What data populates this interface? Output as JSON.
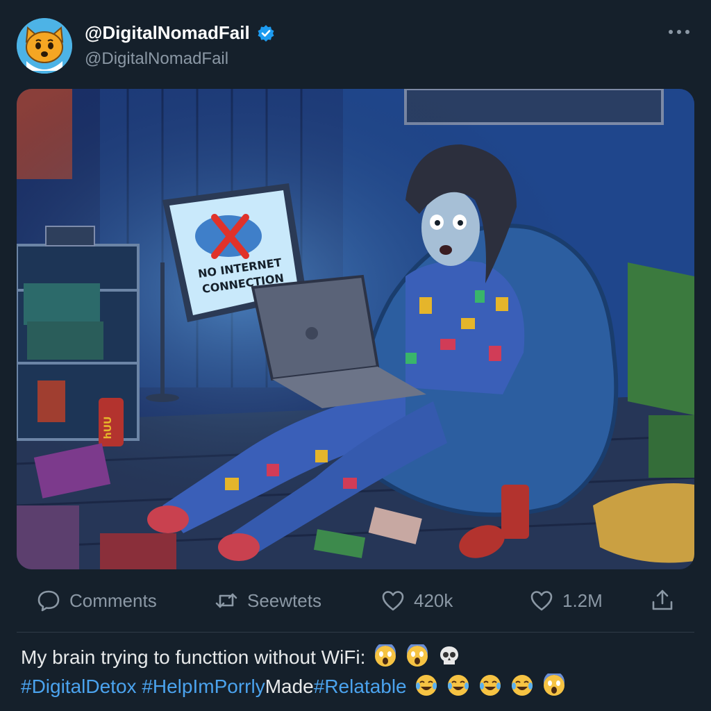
{
  "post": {
    "display_name": "@DigitalNomadFail",
    "handle": "@DigitalNomadFail",
    "verified": true,
    "text_line1": "My brain trying to functtion without WiFi:",
    "text_line1_emojis": [
      "face-screaming-in-fear",
      "face-screaming-in-fear",
      "skull"
    ],
    "hashtags": [
      "#DigitalDetox",
      "#HelpImPorrly",
      "#Relatable"
    ],
    "hashtag_joiner": "Made",
    "text_line2_emojis": [
      "face-with-tears-of-joy",
      "face-with-tears-of-joy",
      "face-with-tears-of-joy",
      "face-with-tears-of-joy",
      "face-screaming-in-fear"
    ]
  },
  "media": {
    "sign_line1": "NO INTERNET",
    "sign_line2": "CONNECTION",
    "can_label": "hUU"
  },
  "actions": {
    "comments_label": "Comments",
    "retweets_label": "Seewtets",
    "likes_count": "420k",
    "views_count": "1.2M"
  },
  "colors": {
    "background": "#15202b",
    "hashtag": "#4ba3ee",
    "muted": "#8b98a5",
    "verified": "#1d9bf0"
  }
}
